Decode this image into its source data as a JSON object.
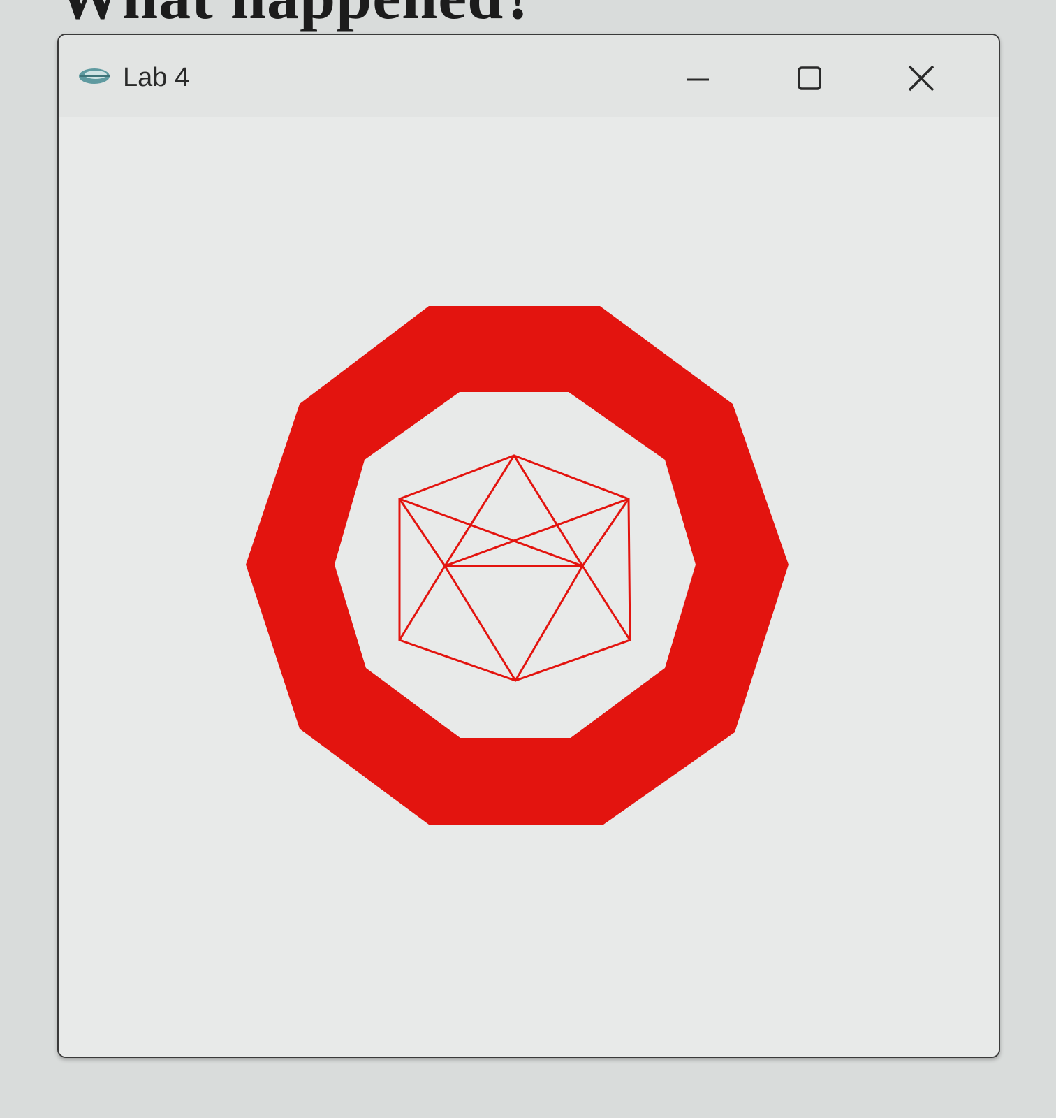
{
  "page": {
    "heading": "What happened?"
  },
  "window": {
    "title": "Lab 4",
    "app_icon": "eclipse-icon",
    "controls": {
      "minimize_icon": "minimize-icon",
      "maximize_icon": "maximize-icon",
      "close_icon": "close-icon"
    }
  },
  "drawing": {
    "ring_shape": "decagon-ring",
    "inner_figure": "icosahedron-wireframe",
    "color": "#e3140f"
  }
}
